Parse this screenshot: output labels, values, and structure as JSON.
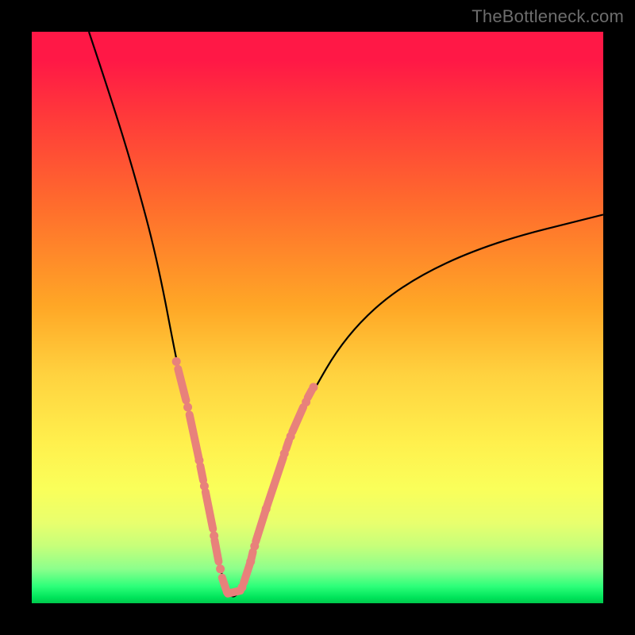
{
  "watermark": "TheBottleneck.com",
  "chart_data": {
    "type": "line",
    "title": "",
    "xlabel": "",
    "ylabel": "",
    "xlim": [
      0,
      100
    ],
    "ylim": [
      0,
      100
    ],
    "annotations": {
      "description": "V-shaped bottleneck curve with highlighted near-zero band",
      "minimum_x": 35,
      "gradient_stops": [
        {
          "pos": 0,
          "color": "#ff1846"
        },
        {
          "pos": 30,
          "color": "#ff6b2d"
        },
        {
          "pos": 60,
          "color": "#ffd23f"
        },
        {
          "pos": 85,
          "color": "#e8ff6e"
        },
        {
          "pos": 100,
          "color": "#00c84c"
        }
      ]
    },
    "series": [
      {
        "name": "bottleneck-curve",
        "x": [
          10,
          14,
          18,
          22,
          25.6,
          27,
          28.5,
          30,
          31,
          32,
          33,
          34,
          35,
          36,
          37,
          38,
          39.5,
          41,
          43,
          45,
          48,
          55,
          65,
          80,
          100
        ],
        "y": [
          100,
          88,
          75,
          60,
          41,
          35.5,
          29.5,
          21.5,
          16.5,
          11,
          6,
          2.5,
          1,
          1.5,
          3,
          6,
          11,
          16,
          22,
          28,
          35,
          47,
          56,
          63,
          68
        ]
      }
    ],
    "highlight_segments": [
      {
        "x0": 25.6,
        "y0": 41.0,
        "x1": 27.0,
        "y1": 35.5
      },
      {
        "x0": 27.6,
        "y0": 33.0,
        "x1": 29.2,
        "y1": 25.5
      },
      {
        "x0": 29.5,
        "y0": 24.0,
        "x1": 30.0,
        "y1": 21.5
      },
      {
        "x0": 30.4,
        "y0": 19.5,
        "x1": 31.7,
        "y1": 13.0
      },
      {
        "x0": 32.0,
        "y0": 11.0,
        "x1": 32.7,
        "y1": 7.3
      },
      {
        "x0": 33.3,
        "y0": 4.5,
        "x1": 34.0,
        "y1": 2.4
      },
      {
        "x0": 34.3,
        "y0": 1.7,
        "x1": 36.5,
        "y1": 2.2
      },
      {
        "x0": 37.1,
        "y0": 3.6,
        "x1": 38.2,
        "y1": 7.0
      },
      {
        "x0": 38.3,
        "y0": 7.3,
        "x1": 38.7,
        "y1": 9.0
      },
      {
        "x0": 39.2,
        "y0": 10.8,
        "x1": 40.9,
        "y1": 16.2
      },
      {
        "x0": 41.0,
        "y0": 16.5,
        "x1": 44.0,
        "y1": 25.5
      },
      {
        "x0": 44.5,
        "y0": 27.0,
        "x1": 45.0,
        "y1": 28.5
      },
      {
        "x0": 45.6,
        "y0": 30.0,
        "x1": 47.5,
        "y1": 34.3
      },
      {
        "x0": 48.3,
        "y0": 36.0,
        "x1": 49.0,
        "y1": 37.3
      }
    ],
    "highlight_dots": [
      {
        "x": 25.3,
        "y": 42.3
      },
      {
        "x": 27.3,
        "y": 34.3
      },
      {
        "x": 29.3,
        "y": 25.0
      },
      {
        "x": 30.2,
        "y": 20.5
      },
      {
        "x": 31.9,
        "y": 11.8
      },
      {
        "x": 33.0,
        "y": 6.0
      },
      {
        "x": 34.2,
        "y": 2.0
      },
      {
        "x": 36.8,
        "y": 2.8
      },
      {
        "x": 38.3,
        "y": 7.3
      },
      {
        "x": 39.0,
        "y": 10.0
      },
      {
        "x": 41.0,
        "y": 16.5
      },
      {
        "x": 44.2,
        "y": 26.2
      },
      {
        "x": 45.3,
        "y": 29.2
      },
      {
        "x": 48.0,
        "y": 35.2
      },
      {
        "x": 49.3,
        "y": 37.8
      }
    ]
  }
}
